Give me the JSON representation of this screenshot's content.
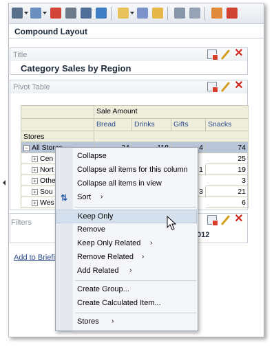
{
  "window": {
    "title": "Compound Layout"
  },
  "toolbar": {
    "buttons": [
      "print-icon",
      "export-icon",
      "copy-icon",
      "preview-icon",
      "share-icon",
      "refresh-icon",
      "new-view-icon",
      "insert-icon",
      "edit-icon",
      "save-icon",
      "display-icon",
      "properties-icon",
      "delete-icon"
    ]
  },
  "title_section": {
    "label": "Title",
    "text": "Category Sales by Region"
  },
  "pivot_section": {
    "label": "Pivot Table",
    "measure_header": "Sale Amount",
    "row_header": "Stores",
    "columns": [
      "Bread",
      "Drinks",
      "Gifts",
      "Snacks"
    ],
    "rows": [
      {
        "label": "All Stores",
        "values": [
          "34",
          "118",
          "4",
          "74"
        ]
      },
      {
        "label": "Cen",
        "values": [
          "",
          "",
          "",
          "25"
        ]
      },
      {
        "label": "Nort",
        "values": [
          "",
          "",
          "1",
          "19"
        ]
      },
      {
        "label": "Othe",
        "values": [
          "",
          "",
          "",
          "3"
        ]
      },
      {
        "label": "Sou",
        "values": [
          "",
          "",
          "3",
          "21"
        ]
      },
      {
        "label": "Wes",
        "values": [
          "",
          "",
          "",
          "6"
        ]
      }
    ]
  },
  "filters_section": {
    "label": "Filters",
    "year_fragment": "012"
  },
  "links": {
    "add_briefing": "Add to Briefi"
  },
  "context_menu": {
    "items": [
      {
        "label": "Collapse",
        "submenu": false
      },
      {
        "label": "Collapse all items for this column",
        "submenu": false
      },
      {
        "label": "Collapse all items in view",
        "submenu": false
      },
      {
        "label": "Sort",
        "submenu": true
      },
      {
        "label": "Keep Only",
        "submenu": false,
        "highlighted": true
      },
      {
        "label": "Remove",
        "submenu": false
      },
      {
        "label": "Keep Only Related",
        "submenu": true
      },
      {
        "label": "Remove Related",
        "submenu": true
      },
      {
        "label": "Add Related",
        "submenu": true
      },
      {
        "label": "Create Group...",
        "submenu": false
      },
      {
        "label": "Create Calculated Item...",
        "submenu": false
      },
      {
        "label": "Stores",
        "submenu": true
      }
    ]
  },
  "colors": {
    "accent_link": "#2a4a8a",
    "selection": "#b9c5d8",
    "header_bg": "#efeedd",
    "menu_highlight": "#d5e0ee",
    "close_red": "#d3261d"
  }
}
